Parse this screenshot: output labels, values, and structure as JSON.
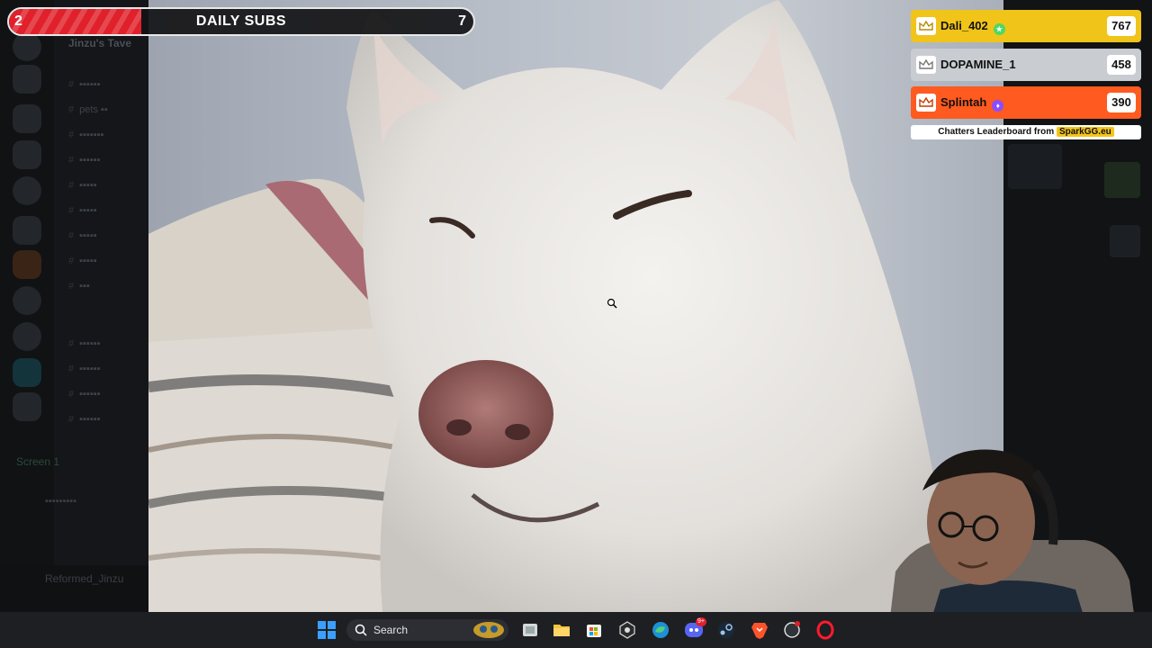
{
  "subs_bar": {
    "current": "2",
    "label": "DAILY SUBS",
    "goal": "7",
    "progress": 0.285,
    "fill_color": "#e0202a"
  },
  "leaderboard": {
    "entries": [
      {
        "rank": 1,
        "name": "Dali_402",
        "score": "767",
        "color": "#f0c419",
        "badge_color": "#4cd964",
        "badge_icon": "star-icon"
      },
      {
        "rank": 2,
        "name": "DOPAMINE_1",
        "score": "458",
        "color": "#c9ccd1",
        "badge_color": "",
        "badge_icon": ""
      },
      {
        "rank": 3,
        "name": "Splintah",
        "score": "390",
        "color": "#ff5a1f",
        "badge_color": "#8a4dff",
        "badge_icon": "prime-icon"
      }
    ],
    "footer_text": "Chatters Leaderboard from",
    "footer_brand": "SparkGG.eu"
  },
  "sidebar": {
    "server_title": "Jinzu's Tave",
    "screen_label": "Screen 1",
    "user_name": "Reformed_Jinzu"
  },
  "taskbar": {
    "search_placeholder": "Search",
    "icons": [
      "windows-start-icon",
      "search-icon",
      "widgets-icon",
      "task-view-icon",
      "file-explorer-icon",
      "store-icon",
      "obs-icon",
      "edge-icon",
      "discord-icon",
      "steam-icon",
      "brave-icon",
      "app-icon",
      "opera-icon"
    ],
    "discord_badge": "9+"
  }
}
